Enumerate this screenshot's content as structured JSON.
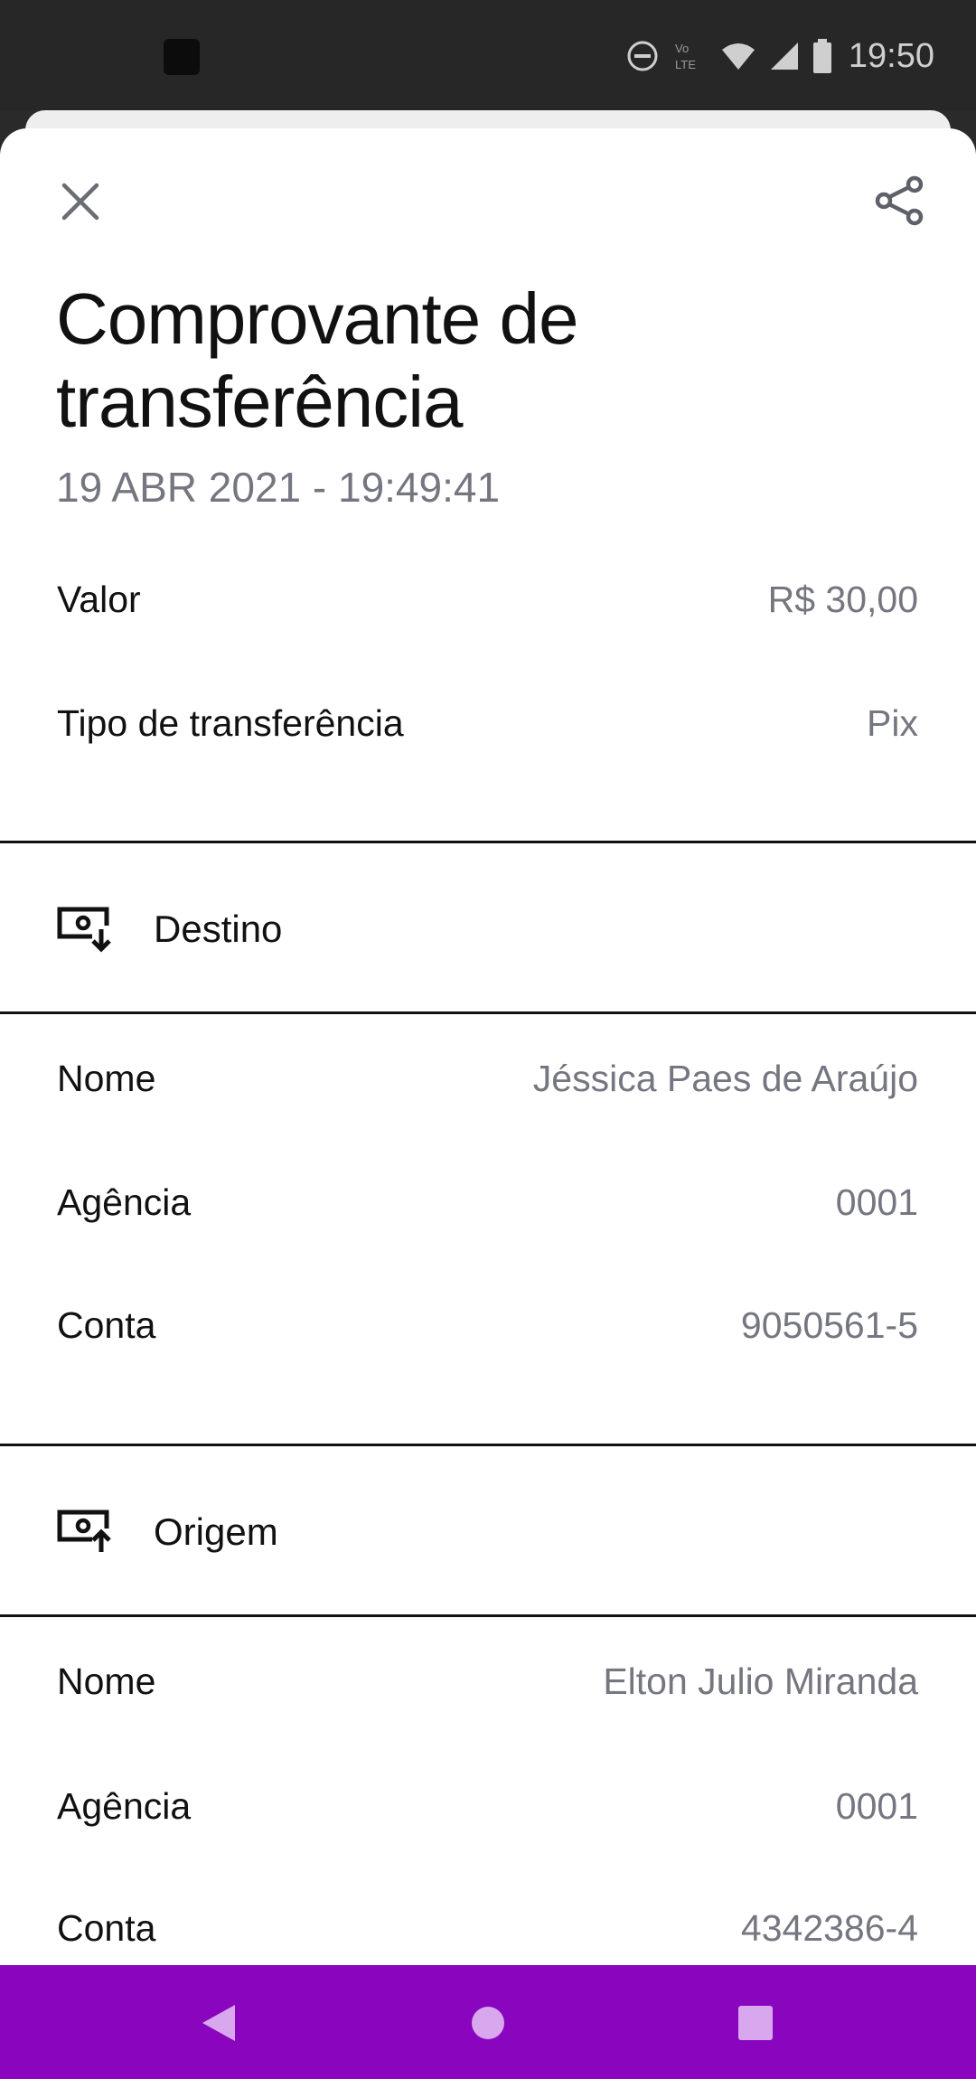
{
  "status_bar": {
    "time": "19:50",
    "icons": [
      "app-notification-icon",
      "do-not-disturb-icon",
      "volte-icon",
      "wifi-icon",
      "cellular-signal-icon",
      "battery-icon"
    ]
  },
  "header": {
    "close_icon": "close-icon",
    "share_icon": "share-icon"
  },
  "receipt": {
    "title": "Comprovante de transferência",
    "date": "19 ABR 2021 - 19:49:41",
    "summary": [
      {
        "label": "Valor",
        "value": "R$ 30,00"
      },
      {
        "label": "Tipo de transferência",
        "value": "Pix"
      }
    ]
  },
  "destination": {
    "title": "Destino",
    "icon": "receive-money-icon",
    "rows": [
      {
        "label": "Nome",
        "value": "Jéssica Paes de Araújo"
      },
      {
        "label": "Agência",
        "value": "0001"
      },
      {
        "label": "Conta",
        "value": "9050561-5"
      }
    ]
  },
  "origin": {
    "title": "Origem",
    "icon": "send-money-icon",
    "rows": [
      {
        "label": "Nome",
        "value": "Elton Julio Miranda"
      },
      {
        "label": "Agência",
        "value": "0001"
      },
      {
        "label": "Conta",
        "value": "4342386-4"
      }
    ]
  },
  "nav_bar": {
    "color": "#8a05be",
    "buttons": [
      "back-icon",
      "home-icon",
      "recents-icon"
    ]
  },
  "colors": {
    "accent": "#8a05be",
    "text_primary": "#111111",
    "text_secondary": "#757680"
  }
}
